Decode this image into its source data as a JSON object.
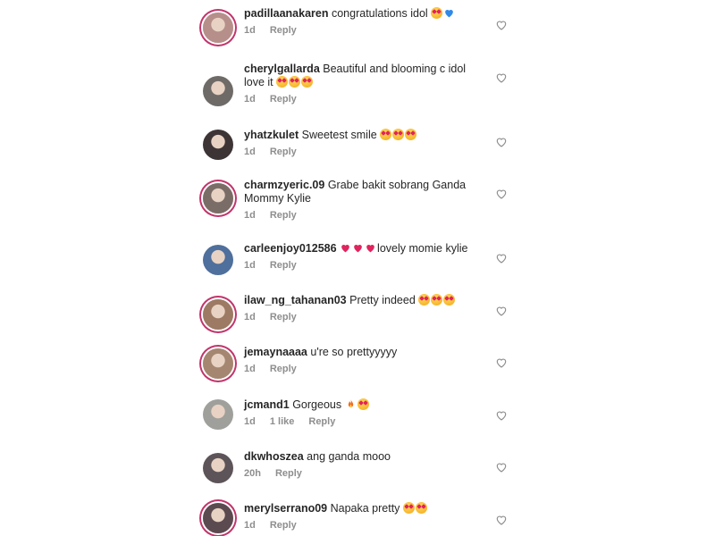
{
  "comments": [
    {
      "username": "padillaanakaren",
      "text": "congratulations idol",
      "emojis": [
        "heart-eyes",
        "blue-heart"
      ],
      "time": "1d",
      "likes": "",
      "reply": "Reply",
      "avatar_color": "#b68f8a",
      "story_ring": true
    },
    {
      "username": "cherylgallarda",
      "text": "Beautiful and blooming c idol love it",
      "emojis": [
        "heart-eyes",
        "heart-eyes",
        "heart-eyes"
      ],
      "time": "1d",
      "likes": "",
      "reply": "Reply",
      "avatar_color": "#6e6a68",
      "story_ring": false
    },
    {
      "username": "yhatzkulet",
      "text": "Sweetest smile",
      "emojis": [
        "heart-eyes",
        "heart-eyes",
        "heart-eyes"
      ],
      "time": "1d",
      "likes": "",
      "reply": "Reply",
      "avatar_color": "#3d3436",
      "story_ring": false
    },
    {
      "username": "charmzyeric.09",
      "text": "Grabe bakit sobrang Ganda Mommy Kylie",
      "emojis": [],
      "time": "1d",
      "likes": "",
      "reply": "Reply",
      "avatar_color": "#7a6d67",
      "story_ring": true
    },
    {
      "username": "carleenjoy012586",
      "text": "lovely momie kylie",
      "emojis": [
        "red-heart",
        "red-heart",
        "red-heart"
      ],
      "emoji_position": "before",
      "time": "1d",
      "likes": "",
      "reply": "Reply",
      "avatar_color": "#4f6f9c",
      "story_ring": false
    },
    {
      "username": "ilaw_ng_tahanan03",
      "text": "Pretty indeed",
      "emojis": [
        "heart-eyes",
        "heart-eyes",
        "heart-eyes"
      ],
      "time": "1d",
      "likes": "",
      "reply": "Reply",
      "avatar_color": "#9c7a63",
      "story_ring": true
    },
    {
      "username": "jemaynaaaa",
      "text": "u're so prettyyyyy",
      "emojis": [],
      "time": "1d",
      "likes": "",
      "reply": "Reply",
      "avatar_color": "#a58670",
      "story_ring": true
    },
    {
      "username": "jcmand1",
      "text": "Gorgeous",
      "emojis": [
        "fire",
        "heart-eyes"
      ],
      "time": "1d",
      "likes": "1 like",
      "reply": "Reply",
      "avatar_color": "#9fa09b",
      "story_ring": false
    },
    {
      "username": "dkwhoszea",
      "text": "ang ganda mooo",
      "emojis": [],
      "time": "20h",
      "likes": "",
      "reply": "Reply",
      "avatar_color": "#5c5458",
      "story_ring": false
    },
    {
      "username": "merylserrano09",
      "text": "Napaka pretty",
      "emojis": [
        "heart-eyes",
        "heart-eyes"
      ],
      "time": "1d",
      "likes": "",
      "reply": "Reply",
      "avatar_color": "#5b4a4f",
      "story_ring": true
    }
  ],
  "icons": {
    "like": "heart-outline-icon"
  }
}
